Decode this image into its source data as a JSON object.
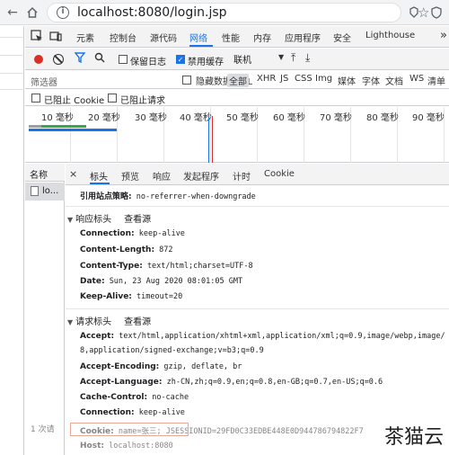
{
  "browser": {
    "url": "localhost:8080/login.jsp",
    "back_icon": "back-arrow-icon",
    "home_icon": "home-icon",
    "info_icon": "info-icon",
    "info_glyph": "i",
    "star_icon": "star-icon",
    "star_glyph": "☆"
  },
  "devtools": {
    "tabs": [
      "元素",
      "控制台",
      "源代码",
      "网络",
      "性能",
      "内存",
      "应用程序",
      "安全",
      "Lighthouse"
    ],
    "active_tab": "网络",
    "toolbar": {
      "preserve_log": "保留日志",
      "disable_cache": "禁用缓存",
      "throttle": "联机",
      "disable_cache_checked": true,
      "preserve_log_checked": false
    },
    "filter": {
      "placeholder": "筛选器",
      "hide_data_urls": "隐藏数据 URL",
      "types": [
        "全部",
        "XHR",
        "JS",
        "CSS",
        "Img",
        "媒体",
        "字体",
        "文档",
        "WS",
        "清单"
      ],
      "active_type": "全部"
    },
    "block_row": {
      "blocked_cookies": "已阻止 Cookie",
      "blocked_requests": "已阻止请求"
    },
    "timeline": {
      "ticks": [
        "10 毫秒",
        "20 毫秒",
        "30 毫秒",
        "40 毫秒",
        "50 毫秒",
        "60 毫秒",
        "70 毫秒",
        "80 毫秒",
        "90 毫秒"
      ]
    },
    "requests": {
      "column_name": "名称",
      "rows": [
        "lo..."
      ],
      "footer": "1 次请"
    },
    "detail_tabs": [
      "标头",
      "预览",
      "响应",
      "发起程序",
      "计时",
      "Cookie"
    ],
    "active_detail_tab": "标头",
    "referrer_policy": {
      "key": "引用站点策略:",
      "value": "no-referrer-when-downgrade"
    },
    "response_headers": {
      "title": "响应标头",
      "view_source": "查看源",
      "items": [
        {
          "key": "Connection:",
          "value": "keep-alive"
        },
        {
          "key": "Content-Length:",
          "value": "872"
        },
        {
          "key": "Content-Type:",
          "value": "text/html;charset=UTF-8"
        },
        {
          "key": "Date:",
          "value": "Sun, 23 Aug 2020 08:01:05 GMT"
        },
        {
          "key": "Keep-Alive:",
          "value": "timeout=20"
        }
      ]
    },
    "request_headers": {
      "title": "请求标头",
      "view_source": "查看源",
      "accept_key": "Accept:",
      "accept_line1": "text/html,application/xhtml+xml,application/xml;q=0.9,image/webp,image/",
      "accept_line2": "8,application/signed-exchange;v=b3;q=0.9",
      "items": [
        {
          "key": "Accept-Encoding:",
          "value": "gzip, deflate, br"
        },
        {
          "key": "Accept-Language:",
          "value": "zh-CN,zh;q=0.9,en;q=0.8,en-GB;q=0.7,en-US;q=0.6"
        },
        {
          "key": "Cache-Control:",
          "value": "no-cache"
        },
        {
          "key": "Connection:",
          "value": "keep-alive"
        }
      ],
      "cookie_key": "Cookie:",
      "cookie_value": "name=张三;",
      "cookie_rest": "JSESSIONID=29FD0C33EDBE448E0D944786794822F7",
      "host_key": "Host:",
      "host_value": "localhost:8080"
    }
  },
  "watermark": "茶猫云",
  "colors": {
    "accent": "#1a73e8",
    "record": "#d93025",
    "highlight_box": "#e8a89a"
  }
}
